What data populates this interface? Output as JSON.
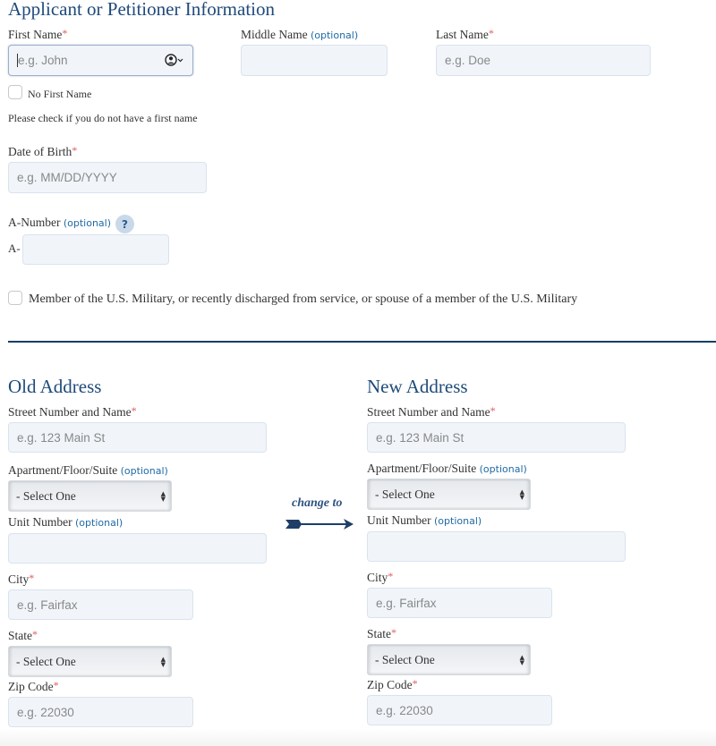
{
  "applicant": {
    "heading": "Applicant or Petitioner Information",
    "first_name": {
      "label": "First Name",
      "required_mark": "*",
      "placeholder": "e.g. John",
      "icon": "contact-autofill-icon"
    },
    "middle_name": {
      "label": "Middle Name",
      "optional": "(optional)",
      "placeholder": ""
    },
    "last_name": {
      "label": "Last Name",
      "required_mark": "*",
      "placeholder": "e.g. Doe"
    },
    "no_first_name": {
      "label": "No First Name",
      "hint": "Please check if you do not have a first name",
      "checked": false
    },
    "dob": {
      "label": "Date of Birth",
      "required_mark": "*",
      "placeholder": "e.g. MM/DD/YYYY"
    },
    "a_number": {
      "label": "A-Number",
      "optional": "(optional)",
      "help": "?",
      "prefix": "A-",
      "placeholder": ""
    },
    "military": {
      "label": "Member of the U.S. Military, or recently discharged from service, or spouse of a member of the U.S. Military",
      "checked": false
    }
  },
  "old_address": {
    "heading": "Old Address",
    "street": {
      "label": "Street Number and Name",
      "required_mark": "*",
      "placeholder": "e.g. 123 Main St"
    },
    "apt": {
      "label": "Apartment/Floor/Suite",
      "optional": "(optional)",
      "selected": "- Select One"
    },
    "unit": {
      "label": "Unit Number",
      "optional": "(optional)",
      "placeholder": ""
    },
    "city": {
      "label": "City",
      "required_mark": "*",
      "placeholder": "e.g. Fairfax"
    },
    "state": {
      "label": "State",
      "required_mark": "*",
      "selected": "- Select One"
    },
    "zip": {
      "label": "Zip Code",
      "required_mark": "*",
      "placeholder": "e.g. 22030"
    }
  },
  "change_to": {
    "label": "change to",
    "icon": "arrow-right-icon"
  },
  "new_address": {
    "heading": "New Address",
    "street": {
      "label": "Street Number and Name",
      "required_mark": "*",
      "placeholder": "e.g. 123 Main St"
    },
    "apt": {
      "label": "Apartment/Floor/Suite",
      "optional": "(optional)",
      "selected": "- Select One"
    },
    "unit": {
      "label": "Unit Number",
      "optional": "(optional)",
      "placeholder": ""
    },
    "city": {
      "label": "City",
      "required_mark": "*",
      "placeholder": "e.g. Fairfax"
    },
    "state": {
      "label": "State",
      "required_mark": "*",
      "selected": "- Select One"
    },
    "zip": {
      "label": "Zip Code",
      "required_mark": "*",
      "placeholder": "e.g. 22030"
    }
  },
  "colors": {
    "heading": "#1f4a7a",
    "required": "#e05a5a",
    "optional": "#1f6aa5",
    "divider": "#163d66",
    "input_bg": "#f1f5fa"
  }
}
